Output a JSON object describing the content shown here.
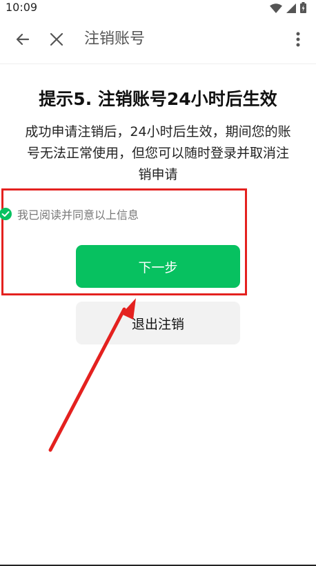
{
  "status_bar": {
    "time": "10:09",
    "icons": [
      "wifi-icon",
      "signal-icon",
      "battery-charging-icon"
    ]
  },
  "toolbar": {
    "title": "注销账号",
    "back_icon": "arrow-left-icon",
    "close_icon": "close-icon",
    "more_icon": "more-vertical-icon"
  },
  "content": {
    "heading": "提示5. 注销账号24小时后生效",
    "description": "成功申请注销后，24小时后生效，期间您的账号无法正常使用，但您可以随时登录并取消注销申请",
    "agreement_text": "我已阅读并同意以上信息",
    "agreement_checked": true
  },
  "actions": {
    "next_label": "下一步",
    "exit_label": "退出注销"
  },
  "colors": {
    "primary": "#07c160",
    "secondary_bg": "#f2f2f2",
    "annotation": "#e4211f"
  }
}
